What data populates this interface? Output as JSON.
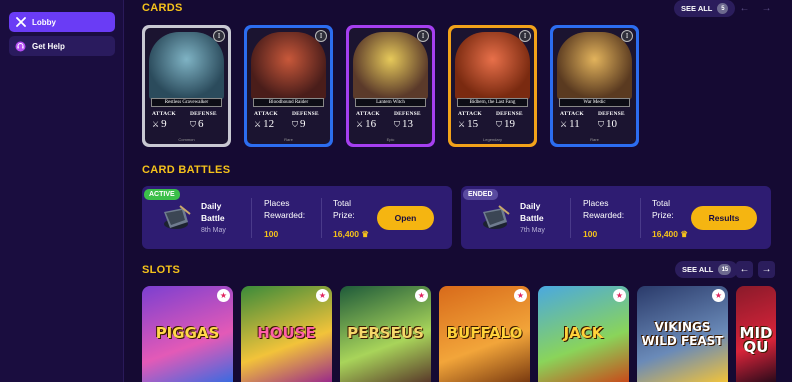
{
  "sidebar": {
    "items": [
      {
        "label": "Lobby",
        "icon": "x-icon",
        "active": true
      },
      {
        "label": "Get Help",
        "icon": "headset-icon",
        "active": false
      }
    ]
  },
  "cards_section": {
    "title": "CARDS",
    "see_all": "SEE ALL",
    "count": "5",
    "cards": [
      {
        "name": "Restless Gravewalker",
        "level": "I",
        "attack_label": "ATTACK",
        "attack": "9",
        "defense_label": "DEFENSE",
        "defense": "6",
        "rarity": "Common",
        "frame": "#c8c8d2"
      },
      {
        "name": "Bloodhound Raider",
        "level": "I",
        "attack_label": "ATTACK",
        "attack": "12",
        "defense_label": "DEFENSE",
        "defense": "9",
        "rarity": "Rare",
        "frame": "#2c6df0"
      },
      {
        "name": "Lantern Witch",
        "level": "I",
        "attack_label": "ATTACK",
        "attack": "16",
        "defense_label": "DEFENSE",
        "defense": "13",
        "rarity": "Epic",
        "frame": "#a53ff0"
      },
      {
        "name": "Bidbern, the Last Fang",
        "level": "I",
        "attack_label": "ATTACK",
        "attack": "15",
        "defense_label": "DEFENSE",
        "defense": "19",
        "rarity": "Legendary",
        "frame": "#f2a21a"
      },
      {
        "name": "War Medic",
        "level": "I",
        "attack_label": "ATTACK",
        "attack": "11",
        "defense_label": "DEFENSE",
        "defense": "10",
        "rarity": "Rare",
        "frame": "#2c6df0"
      }
    ]
  },
  "battles_section": {
    "title": "CARD BATTLES",
    "battles": [
      {
        "status": "ACTIVE",
        "status_color": "#3bbf4a",
        "title": "Daily Battle",
        "date": "8th May",
        "places_label": "Places Rewarded:",
        "places": "100",
        "prize_label": "Total Prize:",
        "prize": "16,400",
        "button": "Open"
      },
      {
        "status": "ENDED",
        "status_color": "#5a4ba0",
        "title": "Daily Battle",
        "date": "7th May",
        "places_label": "Places Rewarded:",
        "places": "100",
        "prize_label": "Total Prize:",
        "prize": "16,400",
        "button": "Results"
      }
    ]
  },
  "slots_section": {
    "title": "SLOTS",
    "see_all": "SEE ALL",
    "count": "15",
    "games": [
      {
        "logo": "PIGGAS"
      },
      {
        "logo": "HOUSE"
      },
      {
        "logo": "PERSEUS"
      },
      {
        "logo": "BUFFALO"
      },
      {
        "logo": "JACK"
      },
      {
        "logo": "VIKINGS WILD FEAST"
      },
      {
        "logo": "MID QU"
      }
    ]
  }
}
